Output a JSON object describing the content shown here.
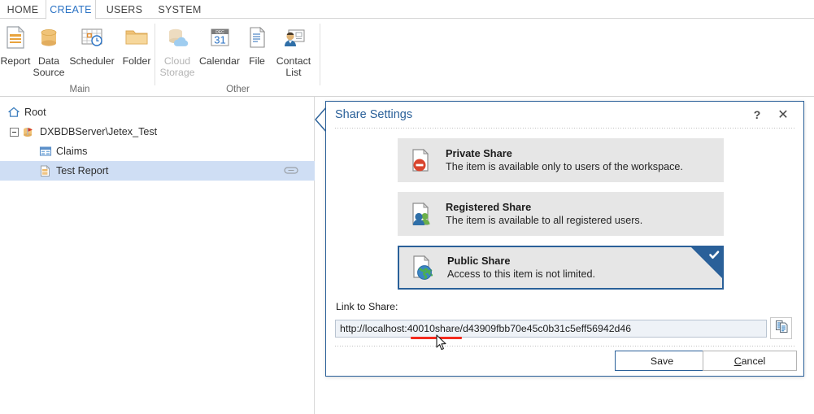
{
  "window": {
    "tabs": [
      {
        "label": "HOME",
        "active": false
      },
      {
        "label": "CREATE",
        "active": true
      },
      {
        "label": "USERS",
        "active": false
      },
      {
        "label": "SYSTEM",
        "active": false
      }
    ]
  },
  "ribbon": {
    "groups": [
      {
        "label": "Main",
        "items": [
          {
            "label": "Report",
            "icon": "report-icon",
            "disabled": false
          },
          {
            "label": "Data\nSource",
            "icon": "data-source-icon",
            "disabled": false
          },
          {
            "label": "Scheduler",
            "icon": "scheduler-icon",
            "disabled": false
          },
          {
            "label": "Folder",
            "icon": "folder-icon",
            "disabled": false
          }
        ]
      },
      {
        "label": "Other",
        "items": [
          {
            "label": "Cloud\nStorage",
            "icon": "cloud-storage-icon",
            "disabled": true
          },
          {
            "label": "Calendar",
            "icon": "calendar-icon",
            "disabled": false
          },
          {
            "label": "File",
            "icon": "file-icon",
            "disabled": false
          },
          {
            "label": "Contact\nList",
            "icon": "contact-list-icon",
            "disabled": false
          }
        ]
      }
    ],
    "calendar_month": "DEC",
    "calendar_day": "31"
  },
  "tree": {
    "nodes": [
      {
        "label": "Root",
        "icon": "home-icon",
        "level": 0,
        "selected": false,
        "expander": false,
        "badge": false
      },
      {
        "label": "DXBDBServer\\Jetex_Test",
        "icon": "database-connection-icon",
        "level": 1,
        "selected": false,
        "expander": true,
        "badge": false
      },
      {
        "label": "Claims",
        "icon": "table-icon",
        "level": 2,
        "selected": false,
        "expander": false,
        "badge": false
      },
      {
        "label": "Test Report",
        "icon": "report-document-icon",
        "level": 2,
        "selected": true,
        "expander": false,
        "badge": true
      }
    ]
  },
  "dialog": {
    "title": "Share Settings",
    "help_label": "?",
    "close_label": "✕",
    "options": [
      {
        "title": "Private Share",
        "desc": "The item is available only to users of the workspace.",
        "icon": "private-share-icon",
        "selected": false
      },
      {
        "title": "Registered Share",
        "desc": "The item is available to all registered users.",
        "icon": "registered-share-icon",
        "selected": false
      },
      {
        "title": "Public Share",
        "desc": "Access to this item is not limited.",
        "icon": "public-share-icon",
        "selected": true
      }
    ],
    "link_label": "Link to Share:",
    "link_value": "http://localhost:40010share/d43909fbb70e45c0b31c5eff56942d46",
    "link_placeholder": "",
    "copy_icon": "copy-icon",
    "save_label": "Save",
    "cancel_label": "Cancel",
    "cancel_accesskey": "C"
  },
  "colors": {
    "accent_blue": "#2a6099",
    "tab_active": "#2a72c4",
    "selection_blue": "#cfdef4",
    "option_bg": "#e6e6e6",
    "underline_red": "#f52b1e"
  }
}
